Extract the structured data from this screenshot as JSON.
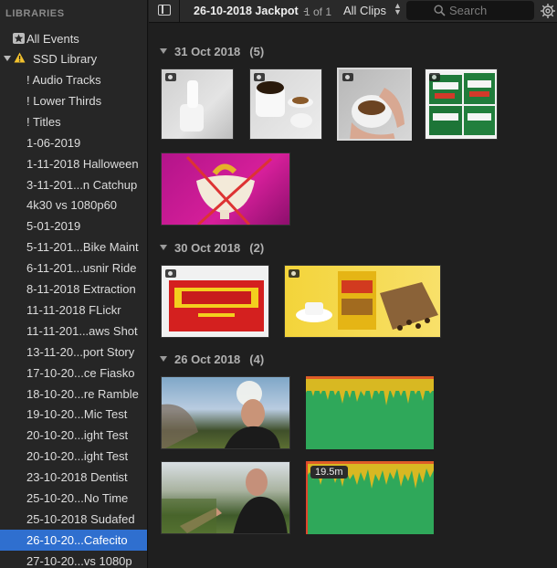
{
  "sidebar": {
    "header": "LIBRARIES",
    "all_events": "All Events",
    "library": "SSD Library",
    "items": [
      "! Audio Tracks",
      "! Lower Thirds",
      "! Titles",
      "1-06-2019",
      "1-11-2018 Halloween",
      "3-11-201...n Catchup",
      "4k30 vs 1080p60",
      "5-01-2019",
      "5-11-201...Bike Maint",
      "6-11-201...usnir Ride",
      "8-11-2018 Extraction",
      "11-11-2018 FLickr",
      "11-11-201...aws Shot",
      "13-11-20...port Story",
      "17-10-20...ce Fiasko",
      "18-10-20...re Ramble",
      "19-10-20...Mic Test",
      "20-10-20...ight Test",
      "20-10-20...ight Test",
      "23-10-2018 Dentist",
      "25-10-20...No Time",
      "25-10-2018 Sudafed",
      "26-10-20...Cafecito",
      "27-10-20...vs 1080p"
    ],
    "selected_index": 22
  },
  "toolbar": {
    "event_title": "26-10-2018 Jackpot",
    "separator": "-",
    "page_count": "1 of 1",
    "filter": "All Clips",
    "search_placeholder": "Search"
  },
  "sections": [
    {
      "date": "31 Oct 2018",
      "count": "(5)"
    },
    {
      "date": "30 Oct 2018",
      "count": "(2)"
    },
    {
      "date": "26 Oct 2018",
      "count": "(4)"
    }
  ],
  "clips": {
    "audio_badge": "19.5m"
  },
  "colors": {
    "selection": "#2f6fcf",
    "audio_green": "#2fa85a",
    "audio_yellow": "#d8b822"
  }
}
